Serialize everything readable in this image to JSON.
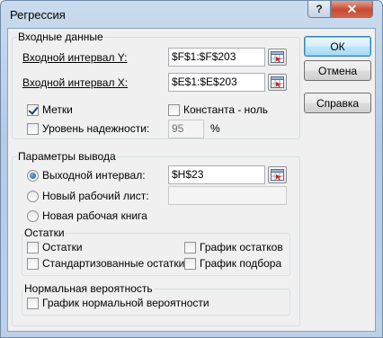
{
  "window": {
    "title": "Регрессия",
    "help_label": "?",
    "close_label": "✕"
  },
  "input_group": {
    "title": "Входные данные",
    "y_label": "Входной интервал Y:",
    "y_value": "$F$1:$F$203",
    "x_label": "Входной интервал X:",
    "x_value": "$E$1:$E$203",
    "labels_label": "Метки",
    "labels_checked": true,
    "constant_zero_label": "Константа - ноль",
    "constant_zero_checked": false,
    "confidence_label": "Уровень надежности:",
    "confidence_checked": false,
    "confidence_value": "95",
    "percent_sign": "%"
  },
  "output_group": {
    "title": "Параметры вывода",
    "output_range_label": "Выходной интервал:",
    "output_range_value": "$H$23",
    "new_sheet_label": "Новый рабочий лист:",
    "new_sheet_value": "",
    "new_workbook_label": "Новая рабочая книга",
    "selected_option": "output_range"
  },
  "residuals_group": {
    "title": "Остатки",
    "residuals_label": "Остатки",
    "standardized_label": "Стандартизованные остатки",
    "residual_plots_label": "График остатков",
    "line_fit_label": "График подбора"
  },
  "normal_group": {
    "title": "Нормальная вероятность",
    "normal_plot_label": "График нормальной вероятности"
  },
  "buttons": {
    "ok": "ОК",
    "cancel": "Отмена",
    "help": "Справка"
  }
}
